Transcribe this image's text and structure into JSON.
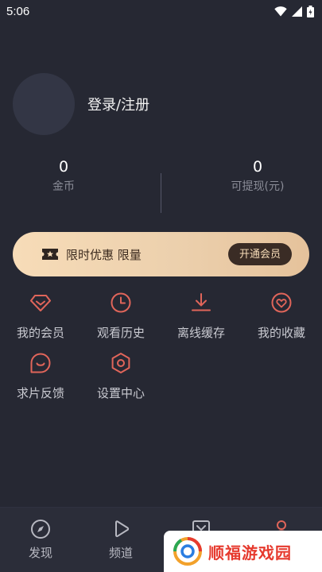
{
  "status_bar": {
    "time": "5:06"
  },
  "profile": {
    "login_label": "登录/注册"
  },
  "stats": {
    "coins": {
      "value": "0",
      "label": "金币"
    },
    "withdrawable": {
      "value": "0",
      "label": "可提现(元)"
    }
  },
  "vip_banner": {
    "promo_text": "限时优惠 限量",
    "button_label": "开通会员",
    "icon": "ticket-star-icon"
  },
  "menu": [
    {
      "label": "我的会员",
      "icon": "diamond-icon"
    },
    {
      "label": "观看历史",
      "icon": "clock-icon"
    },
    {
      "label": "离线缓存",
      "icon": "download-icon"
    },
    {
      "label": "我的收藏",
      "icon": "heart-icon"
    },
    {
      "label": "求片反馈",
      "icon": "feedback-icon"
    },
    {
      "label": "设置中心",
      "icon": "settings-icon"
    }
  ],
  "bottom_nav": [
    {
      "label": "发现",
      "icon": "compass-icon"
    },
    {
      "label": "频道",
      "icon": "play-icon"
    },
    {
      "label": "",
      "icon": "checklist-icon"
    },
    {
      "label": "",
      "icon": "user-icon"
    }
  ],
  "watermark": {
    "text": "顺福游戏园"
  },
  "colors": {
    "background": "#262833",
    "accent_icon": "#e0655a",
    "vip_gold": "#f7dcb8",
    "vip_button": "#3a2c25",
    "watermark_red": "#e63a2e"
  }
}
